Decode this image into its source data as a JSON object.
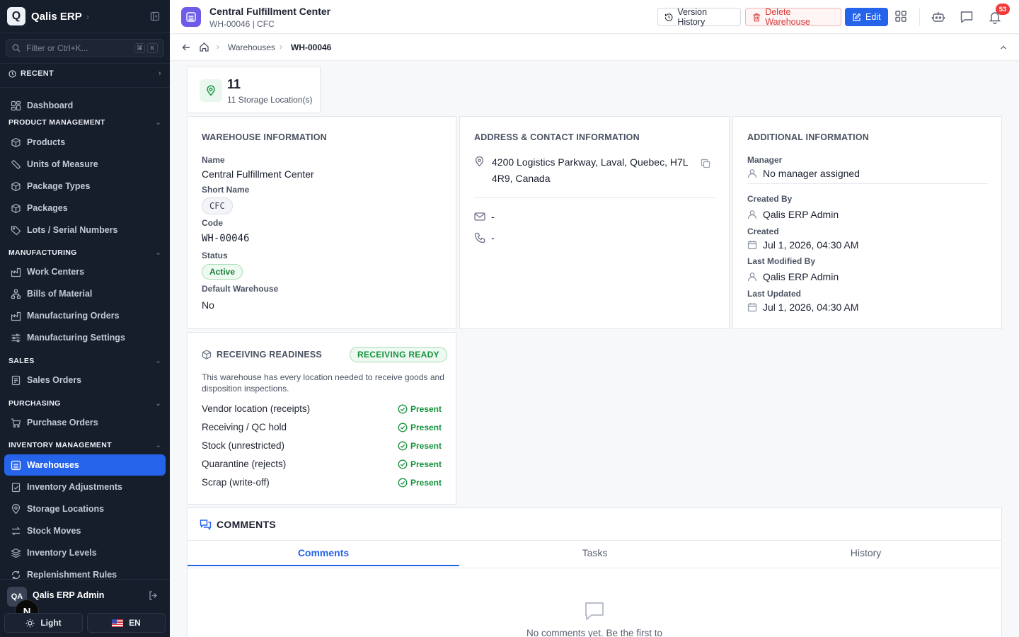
{
  "app": {
    "name": "Qalis ERP",
    "logo_letter": "Q"
  },
  "sidebar": {
    "filter_placeholder": "Filter or Ctrl+K...",
    "shortcut_keys": [
      "⌘",
      "K"
    ],
    "recent_label": "RECENT",
    "dashboard_label": "Dashboard",
    "sections": {
      "product_management": "PRODUCT MANAGEMENT",
      "manufacturing": "MANUFACTURING",
      "sales": "SALES",
      "purchasing": "PURCHASING",
      "inventory_management": "INVENTORY MANAGEMENT"
    },
    "items": {
      "products": "Products",
      "units_of_measure": "Units of Measure",
      "package_types": "Package Types",
      "packages": "Packages",
      "lots_serial_numbers": "Lots / Serial Numbers",
      "work_centers": "Work Centers",
      "bills_of_material": "Bills of Material",
      "manufacturing_orders": "Manufacturing Orders",
      "manufacturing_settings": "Manufacturing Settings",
      "sales_orders": "Sales Orders",
      "purchase_orders": "Purchase Orders",
      "warehouses": "Warehouses",
      "inventory_adjustments": "Inventory Adjustments",
      "storage_locations": "Storage Locations",
      "stock_moves": "Stock Moves",
      "inventory_levels": "Inventory Levels",
      "replenishment_rules": "Replenishment Rules"
    },
    "user": {
      "initials": "QA",
      "name": "Qalis ERP Admin"
    },
    "n_badge": "N",
    "theme_label": "Light",
    "language_label": "EN"
  },
  "header": {
    "title": "Central Fulfillment Center",
    "subtitle": "WH-00046 | CFC",
    "version_history_label": "Version History",
    "delete_label": "Delete Warehouse",
    "edit_label": "Edit",
    "notification_count": "53"
  },
  "breadcrumb": {
    "parent": "Warehouses",
    "current": "WH-00046"
  },
  "stat": {
    "value": "11",
    "label": "11 Storage Location(s)"
  },
  "warehouse_info": {
    "title": "WAREHOUSE INFORMATION",
    "name_label": "Name",
    "name": "Central Fulfillment Center",
    "short_name_label": "Short Name",
    "short_name": "CFC",
    "code_label": "Code",
    "code": "WH-00046",
    "status_label": "Status",
    "status": "Active",
    "default_label": "Default Warehouse",
    "default_value": "No"
  },
  "address_info": {
    "title": "ADDRESS & CONTACT INFORMATION",
    "address_line1": "4200 Logistics Parkway, Laval, Quebec, H7L",
    "address_line2": "4R9, Canada",
    "email": "-",
    "phone": "-"
  },
  "additional_info": {
    "title": "ADDITIONAL INFORMATION",
    "manager_label": "Manager",
    "manager": "No manager assigned",
    "created_by_label": "Created By",
    "created_by": "Qalis ERP Admin",
    "created_label": "Created",
    "created": "Jul 1, 2026, 04:30 AM",
    "modified_by_label": "Last Modified By",
    "modified_by": "Qalis ERP Admin",
    "updated_label": "Last Updated",
    "updated": "Jul 1, 2026, 04:30 AM"
  },
  "receiving": {
    "title": "RECEIVING READINESS",
    "badge": "RECEIVING READY",
    "description": "This warehouse has every location needed to receive goods and disposition inspections.",
    "rows": [
      {
        "label": "Vendor location (receipts)",
        "status": "Present"
      },
      {
        "label": "Receiving / QC hold",
        "status": "Present"
      },
      {
        "label": "Stock (unrestricted)",
        "status": "Present"
      },
      {
        "label": "Quarantine (rejects)",
        "status": "Present"
      },
      {
        "label": "Scrap (write-off)",
        "status": "Present"
      }
    ]
  },
  "comments": {
    "title": "COMMENTS",
    "tabs": [
      "Comments",
      "Tasks",
      "History"
    ],
    "empty_text": "No comments yet. Be the first to"
  },
  "colors": {
    "accent": "#2563eb",
    "sidebar_bg": "#161d2b",
    "success": "#14913b",
    "danger": "#d63a3a",
    "warehouse_icon": "#6d5ce8"
  }
}
